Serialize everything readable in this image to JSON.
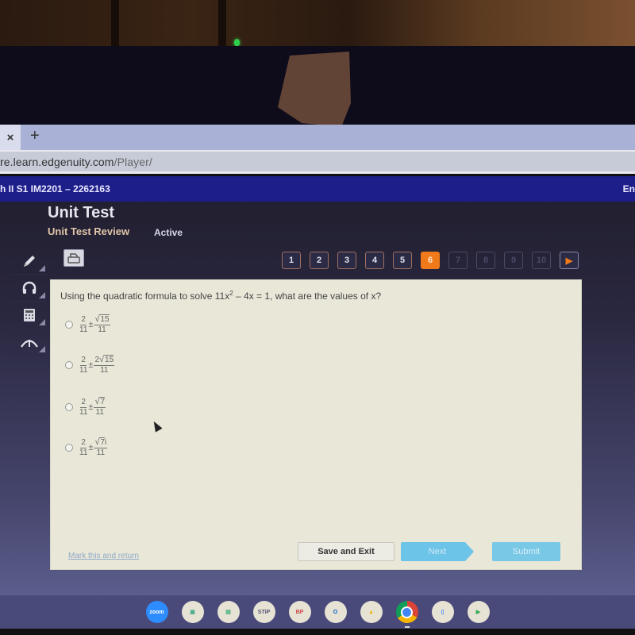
{
  "browser": {
    "tab_close": "×",
    "new_tab": "+",
    "url_host": "re.learn.edgenuity.com",
    "url_path": "/Player/"
  },
  "course": {
    "title": "h II S1 IM2201 – 2262163",
    "right_text": "En"
  },
  "header": {
    "title": "Unit Test",
    "subtitle": "Unit Test Review",
    "status": "Active"
  },
  "tools": [
    {
      "name": "pencil",
      "glyph": "✎"
    },
    {
      "name": "headphones",
      "glyph": "🎧"
    },
    {
      "name": "calculator",
      "glyph": "▦"
    },
    {
      "name": "reference",
      "glyph": "⌃"
    }
  ],
  "pager": {
    "pages": [
      "1",
      "2",
      "3",
      "4",
      "5",
      "6",
      "7",
      "8",
      "9",
      "10"
    ],
    "current": 6,
    "answered_up_to": 5,
    "next_glyph": "▶"
  },
  "question": {
    "prefix": "Using the quadratic formula to solve 11x",
    "exp": "2",
    "suffix": " – 4x = 1, what are the values of x?",
    "choices": [
      {
        "a_num": "2",
        "a_den": "11",
        "pm": "±",
        "b_coef": "",
        "b_rad": "15",
        "b_suffix": "",
        "b_den": "11"
      },
      {
        "a_num": "2",
        "a_den": "11",
        "pm": "±",
        "b_coef": "2",
        "b_rad": "15",
        "b_suffix": "",
        "b_den": "11"
      },
      {
        "a_num": "2",
        "a_den": "11",
        "pm": "±",
        "b_coef": "",
        "b_rad": "7",
        "b_suffix": "",
        "b_den": "11"
      },
      {
        "a_num": "2",
        "a_den": "11",
        "pm": "±",
        "b_coef": "",
        "b_rad": "7",
        "b_suffix": "i",
        "b_den": "11"
      }
    ]
  },
  "actions": {
    "mark": "Mark this and return",
    "save": "Save and Exit",
    "next": "Next",
    "submit": "Submit"
  },
  "shelf": [
    "zoom",
    "classroom-1",
    "classroom-2",
    "STIP",
    "BrainPOP",
    "Outlook",
    "Drive",
    "Chrome",
    "Docs",
    "Play Store"
  ]
}
